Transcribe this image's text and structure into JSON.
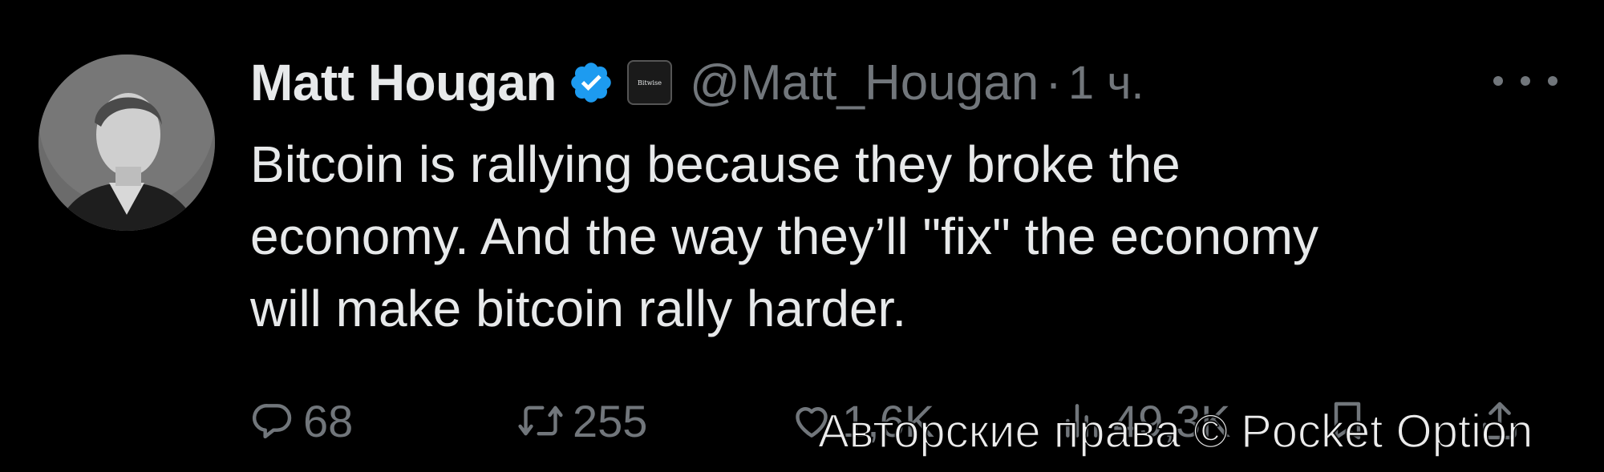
{
  "tweet": {
    "author_name": "Matt Hougan",
    "affiliation_badge_text": "Bitwise",
    "handle": "@Matt_Hougan",
    "separator": "·",
    "time": "1 ч.",
    "text": "Bitcoin is rallying because they broke the\neconomy. And the way they’ll \"fix\" the economy\nwill make bitcoin rally harder.",
    "verified_color": "#1d9bf0"
  },
  "actions": {
    "replies": "68",
    "reposts": "255",
    "likes": "1,6K",
    "views": "49,3K"
  },
  "watermark": {
    "text": "Авторские права © Pocket Option"
  },
  "icons": {
    "verified": "verified-badge-icon",
    "more": "more-dots-icon",
    "reply": "reply-bubble-icon",
    "repost": "repost-arrows-icon",
    "like": "heart-icon",
    "views": "views-bars-icon",
    "bookmark": "bookmark-icon",
    "share": "share-icon"
  }
}
